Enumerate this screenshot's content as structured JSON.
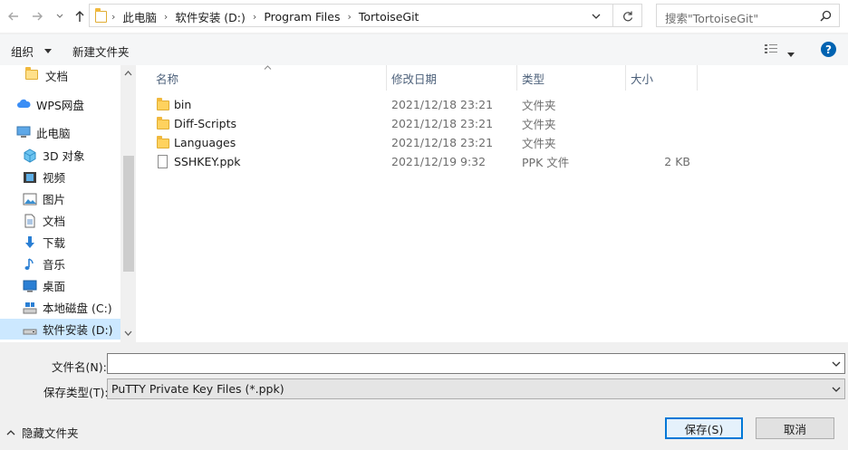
{
  "nav": {
    "breadcrumb": [
      "此电脑",
      "软件安装 (D:)",
      "Program Files",
      "TortoiseGit"
    ],
    "search_placeholder": "搜索\"TortoiseGit\""
  },
  "toolbar": {
    "organize": "组织",
    "new_folder": "新建文件夹"
  },
  "sidebar": {
    "items": [
      {
        "label": "文档",
        "icon": "folder-icon"
      },
      {
        "label": "WPS网盘",
        "icon": "cloud-icon"
      },
      {
        "label": "此电脑",
        "icon": "computer-icon"
      },
      {
        "label": "3D 对象",
        "icon": "3d-objects-icon"
      },
      {
        "label": "视频",
        "icon": "video-icon"
      },
      {
        "label": "图片",
        "icon": "picture-icon"
      },
      {
        "label": "文档",
        "icon": "document-icon"
      },
      {
        "label": "下载",
        "icon": "download-icon"
      },
      {
        "label": "音乐",
        "icon": "music-icon"
      },
      {
        "label": "桌面",
        "icon": "desktop-icon"
      },
      {
        "label": "本地磁盘 (C:)",
        "icon": "drive-icon"
      },
      {
        "label": "软件安装 (D:)",
        "icon": "drive-icon"
      }
    ]
  },
  "list": {
    "columns": [
      "名称",
      "修改日期",
      "类型",
      "大小"
    ],
    "rows": [
      {
        "name": "bin",
        "date": "2021/12/18 23:21",
        "type": "文件夹",
        "size": ""
      },
      {
        "name": "Diff-Scripts",
        "date": "2021/12/18 23:21",
        "type": "文件夹",
        "size": ""
      },
      {
        "name": "Languages",
        "date": "2021/12/18 23:21",
        "type": "文件夹",
        "size": ""
      },
      {
        "name": "SSHKEY.ppk",
        "date": "2021/12/19 9:32",
        "type": "PPK 文件",
        "size": "2 KB"
      }
    ]
  },
  "form": {
    "filename_label": "文件名(N):",
    "filename_value": "",
    "filetype_label": "保存类型(T):",
    "filetype_value": "PuTTY Private Key Files (*.ppk)",
    "hide_folders": "隐藏文件夹",
    "save": "保存(S)",
    "cancel": "取消"
  },
  "colors": {
    "accent": "#0078d7",
    "selection": "#cce8ff",
    "folder": "#ffd25e"
  }
}
